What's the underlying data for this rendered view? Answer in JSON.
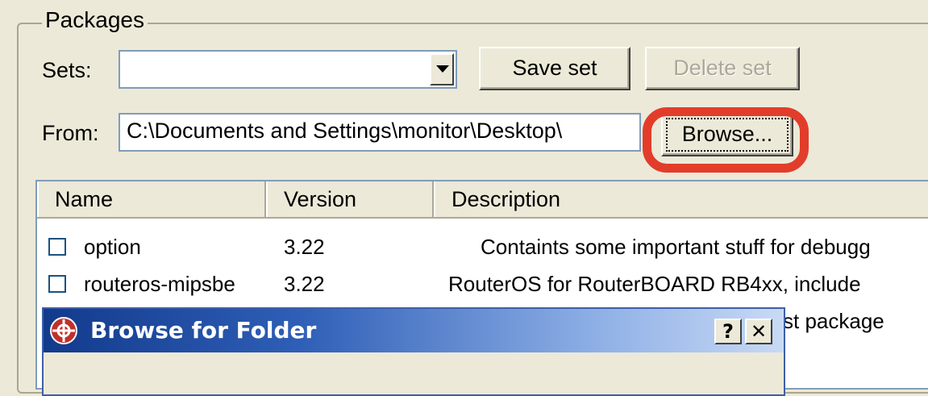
{
  "packages_group": {
    "title": "Packages",
    "sets_label": "Sets:",
    "sets_value": "",
    "save_set_label": "Save set",
    "delete_set_label": "Delete set",
    "from_label": "From:",
    "from_value": "C:\\Documents and Settings\\monitor\\Desktop\\",
    "browse_label": "Browse..."
  },
  "highlight_color": "#e23d2a",
  "package_list": {
    "columns": [
      "Name",
      "Version",
      "Description"
    ],
    "rows": [
      {
        "name": "option",
        "version": "3.22",
        "description": "Containts some important stuff for debugg",
        "checked": false
      },
      {
        "name": "routeros-mipsbe",
        "version": "3.22",
        "description": "RouterOS for RouterBOARD RB4xx, include",
        "checked": false
      },
      {
        "name": "",
        "version": "",
        "description": "st package",
        "checked": false
      }
    ]
  },
  "browse_dialog": {
    "title": "Browse for Folder",
    "help_label": "?",
    "close_label": "✕",
    "icon": "winbox-app-icon"
  }
}
